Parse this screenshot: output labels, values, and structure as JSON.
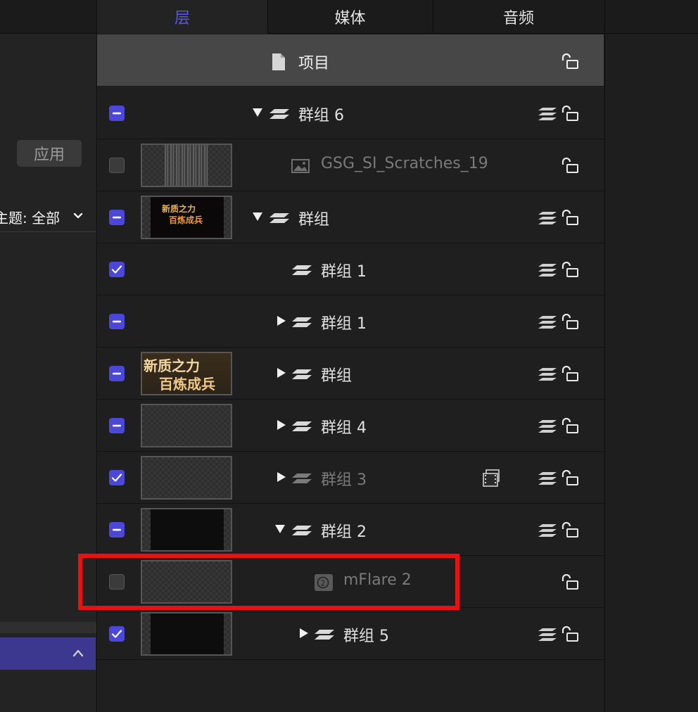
{
  "tabs": {
    "layers": "层",
    "media": "媒体",
    "audio": "音频"
  },
  "left_panel": {
    "apply_label": "应用",
    "theme_label": "主题: 全部"
  },
  "project": {
    "label": "项目"
  },
  "layers": [
    {
      "name": "群组 6",
      "checkbox": "mixed",
      "expand": "expanded",
      "icon": "layers-icon",
      "thumbnail": "none",
      "stack": true
    },
    {
      "name": "GSG_SI_Scratches_19",
      "checkbox": "off",
      "expand": "none",
      "icon": "image-icon",
      "thumbnail": "scratches",
      "stack": false,
      "dim": true
    },
    {
      "name": "群组",
      "checkbox": "mixed",
      "expand": "expanded",
      "icon": "layers-icon",
      "thumbnail": "title-dark",
      "stack": true
    },
    {
      "name": "群组 1",
      "checkbox": "on",
      "expand": "none",
      "icon": "layers-icon",
      "thumbnail": "none",
      "stack": true
    },
    {
      "name": "群组 1",
      "checkbox": "mixed",
      "expand": "collapsed",
      "icon": "layers-icon",
      "thumbnail": "none",
      "stack": true
    },
    {
      "name": "群组",
      "checkbox": "mixed",
      "expand": "collapsed",
      "icon": "layers-icon",
      "thumbnail": "title-gold",
      "stack": true
    },
    {
      "name": "群组 4",
      "checkbox": "mixed",
      "expand": "collapsed",
      "icon": "layers-icon",
      "thumbnail": "empty",
      "stack": true
    },
    {
      "name": "群组 3",
      "checkbox": "on",
      "expand": "collapsed",
      "icon": "layers-icon",
      "thumbnail": "empty",
      "stack": true,
      "dim": true,
      "extra_icon": "film-icon"
    },
    {
      "name": "群组 2",
      "checkbox": "mixed",
      "expand": "expanded",
      "icon": "layers-icon",
      "thumbnail": "dark",
      "stack": true
    },
    {
      "name": "mFlare 2",
      "checkbox": "off",
      "expand": "none",
      "icon": "flare-icon",
      "thumbnail": "empty",
      "stack": false,
      "dim": true,
      "highlighted": true
    },
    {
      "name": "群组 5",
      "checkbox": "on",
      "expand": "collapsed",
      "icon": "layers-icon",
      "thumbnail": "dark",
      "stack": true
    }
  ],
  "thumbnail_text": {
    "line1": "新质之力",
    "line2": "百炼成兵"
  },
  "colors": {
    "accent": "#4b47d8",
    "highlight": "#f10e0e",
    "tab_active": "#5b57e6"
  }
}
